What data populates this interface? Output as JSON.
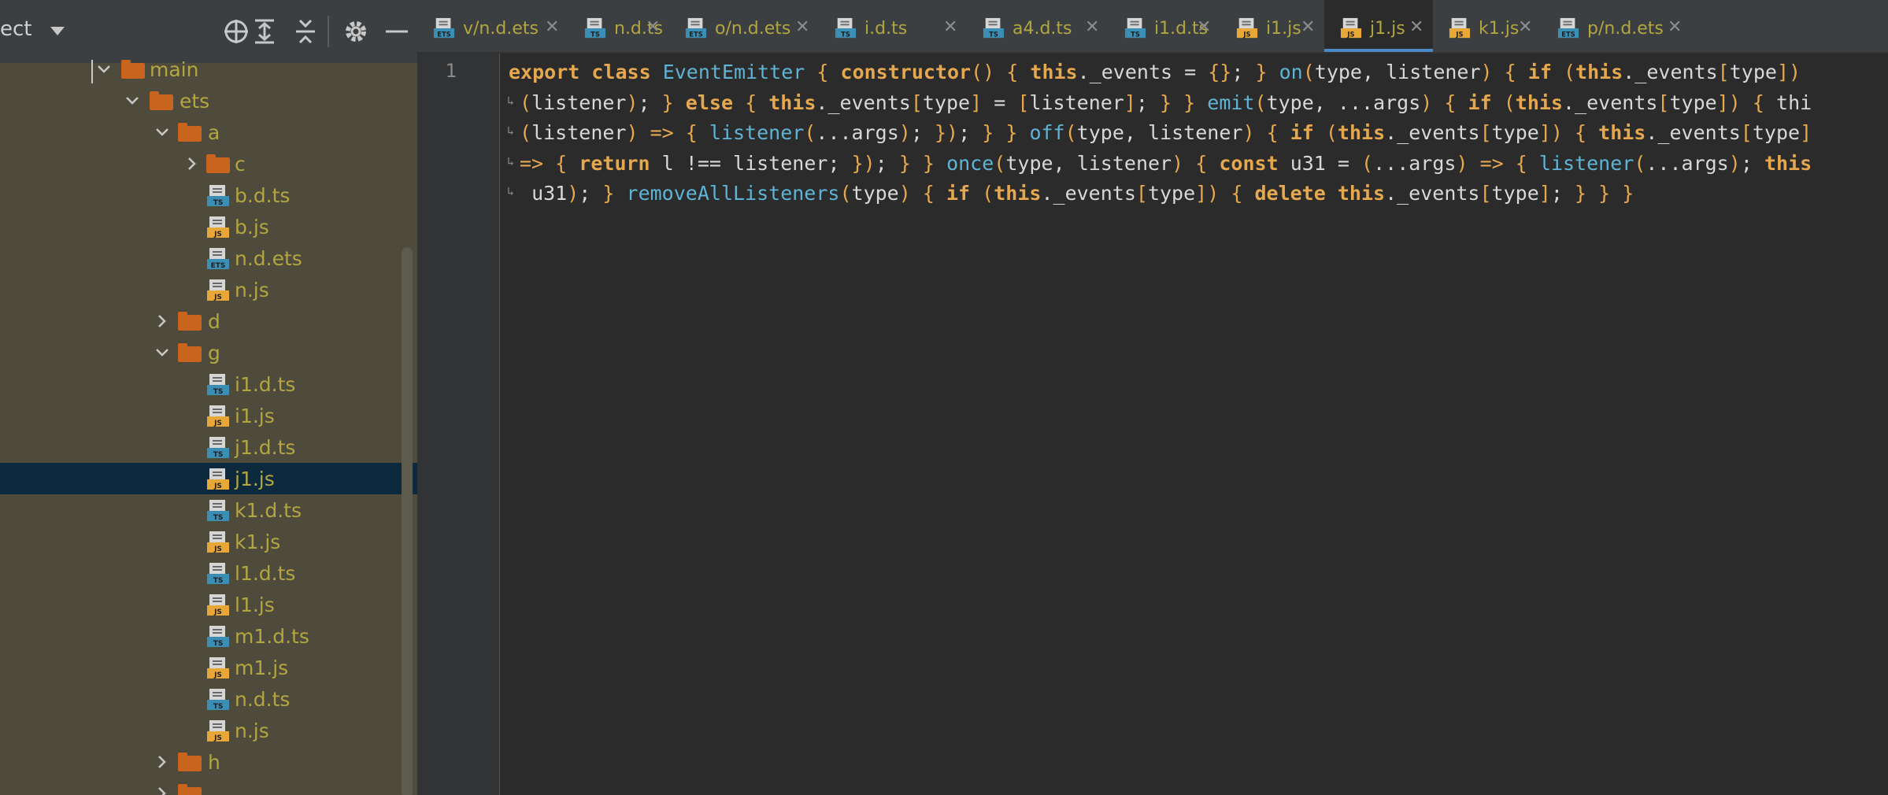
{
  "project_panel": {
    "title": "ect",
    "header_icons": [
      "crosshair-icon",
      "expand-all-icon",
      "collapse-all-icon",
      "gear-icon",
      "minimize-icon"
    ]
  },
  "tree": [
    {
      "label": "main",
      "type": "folder",
      "depth": 0,
      "expanded": true
    },
    {
      "label": "ets",
      "type": "folder",
      "depth": 1,
      "expanded": true
    },
    {
      "label": "a",
      "type": "folder",
      "depth": 2,
      "expanded": true
    },
    {
      "label": "c",
      "type": "folder",
      "depth": 3,
      "expanded": false
    },
    {
      "label": "b.d.ts",
      "type": "ts",
      "depth": 3
    },
    {
      "label": "b.js",
      "type": "js",
      "depth": 3
    },
    {
      "label": "n.d.ets",
      "type": "ets",
      "depth": 3
    },
    {
      "label": "n.js",
      "type": "js",
      "depth": 3
    },
    {
      "label": "d",
      "type": "folder",
      "depth": 2,
      "expanded": false
    },
    {
      "label": "g",
      "type": "folder",
      "depth": 2,
      "expanded": true
    },
    {
      "label": "i1.d.ts",
      "type": "ts",
      "depth": 3
    },
    {
      "label": "i1.js",
      "type": "js",
      "depth": 3
    },
    {
      "label": "j1.d.ts",
      "type": "ts",
      "depth": 3
    },
    {
      "label": "j1.js",
      "type": "js",
      "depth": 3,
      "selected": true
    },
    {
      "label": "k1.d.ts",
      "type": "ts",
      "depth": 3
    },
    {
      "label": "k1.js",
      "type": "js",
      "depth": 3
    },
    {
      "label": "l1.d.ts",
      "type": "ts",
      "depth": 3
    },
    {
      "label": "l1.js",
      "type": "js",
      "depth": 3
    },
    {
      "label": "m1.d.ts",
      "type": "ts",
      "depth": 3
    },
    {
      "label": "m1.js",
      "type": "js",
      "depth": 3
    },
    {
      "label": "n.d.ts",
      "type": "ts",
      "depth": 3
    },
    {
      "label": "n.js",
      "type": "js",
      "depth": 3
    },
    {
      "label": "h",
      "type": "folder",
      "depth": 2,
      "expanded": false
    },
    {
      "label": "",
      "type": "folder",
      "depth": 2,
      "expanded": false
    }
  ],
  "tabs": [
    {
      "label": "v/n.d.ets",
      "type": "ets"
    },
    {
      "label": "n.d.ts",
      "type": "ts"
    },
    {
      "label": "o/n.d.ets",
      "type": "ets"
    },
    {
      "label": "i.d.ts",
      "type": "ts"
    },
    {
      "label": "a4.d.ts",
      "type": "ts"
    },
    {
      "label": "i1.d.ts",
      "type": "ts"
    },
    {
      "label": "i1.js",
      "type": "js"
    },
    {
      "label": "j1.js",
      "type": "js",
      "active": true
    },
    {
      "label": "k1.js",
      "type": "js"
    },
    {
      "label": "p/n.d.ets",
      "type": "ets"
    }
  ],
  "editor": {
    "line_number": "1",
    "code_lines": [
      "export class EventEmitter { constructor() { this._events = {}; } on(type, listener) { if (this._events[type])",
      "(listener); } else { this._events[type] = [listener]; } } emit(type, ...args) { if (this._events[type]) { thi",
      "(listener) => { listener(...args); }); } } off(type, listener) { if (this._events[type]) { this._events[type]",
      "=> { return l !== listener; }); } } once(type, listener) { const u31 = (...args) => { listener(...args); this",
      " u31); } removeAllListeners(type) { if (this._events[type]) { delete this._events[type]; } } }"
    ]
  },
  "colors": {
    "keyword": "#e6a84f",
    "function": "#5fb4d6",
    "text": "#d8d8d8",
    "file_label": "#b3a640",
    "folder": "#c8641e",
    "selection": "#0d293e",
    "active_tab_underline": "#4a88c7"
  }
}
